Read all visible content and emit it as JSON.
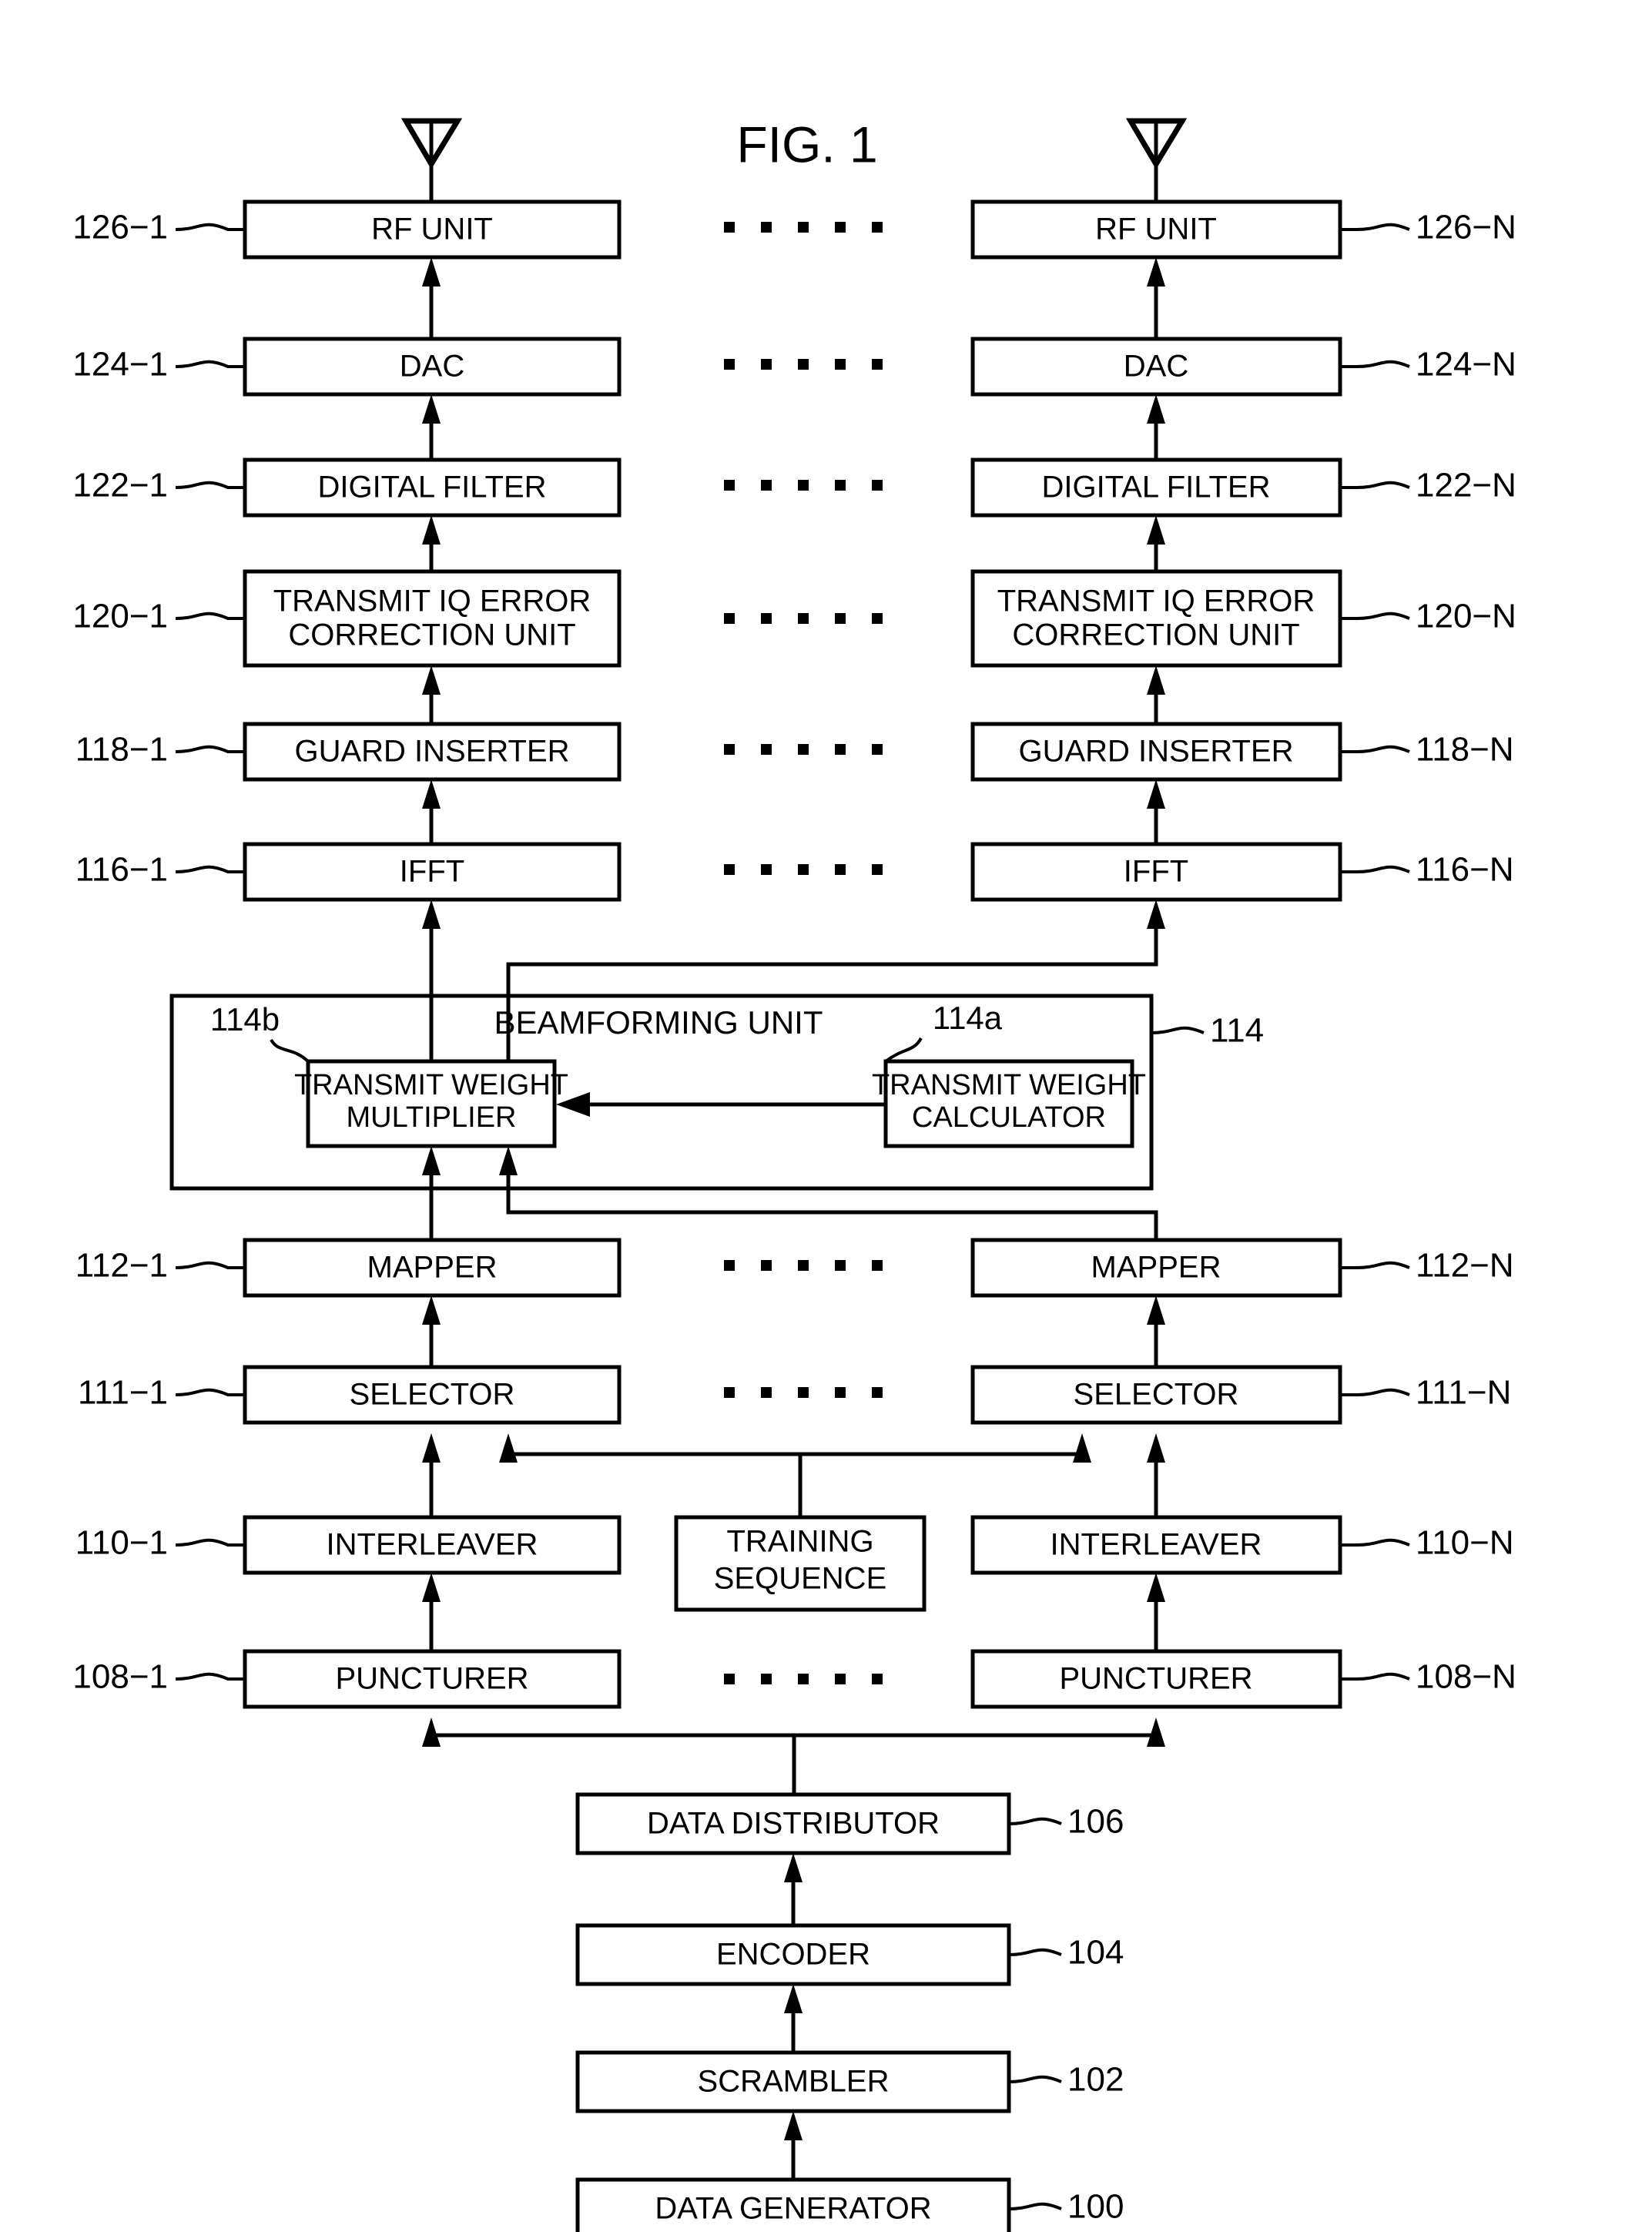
{
  "figure": {
    "title": "FIG. 1",
    "kind": "patent-block-diagram"
  },
  "columns": {
    "left_suffix": "1",
    "right_suffix": "N"
  },
  "chain_blocks": [
    {
      "label": "RF UNIT",
      "ref_left": "126−1",
      "ref_right": "126−N"
    },
    {
      "label": "DAC",
      "ref_left": "124−1",
      "ref_right": "124−N"
    },
    {
      "label": "DIGITAL FILTER",
      "ref_left": "122−1",
      "ref_right": "122−N"
    },
    {
      "label": "TRANSMIT IQ ERROR CORRECTION UNIT",
      "ref_left": "120−1",
      "ref_right": "120−N",
      "line1": "TRANSMIT IQ ERROR",
      "line2": "CORRECTION UNIT"
    },
    {
      "label": "GUARD INSERTER",
      "ref_left": "118−1",
      "ref_right": "118−N"
    },
    {
      "label": "IFFT",
      "ref_left": "116−1",
      "ref_right": "116−N"
    },
    {
      "label": "MAPPER",
      "ref_left": "112−1",
      "ref_right": "112−N"
    },
    {
      "label": "SELECTOR",
      "ref_left": "111−1",
      "ref_right": "111−N"
    },
    {
      "label": "INTERLEAVER",
      "ref_left": "110−1",
      "ref_right": "110−N"
    },
    {
      "label": "PUNCTURER",
      "ref_left": "108−1",
      "ref_right": "108−N"
    }
  ],
  "beamforming": {
    "unit_title": "BEAMFORMING UNIT",
    "unit_ref": "114",
    "multiplier": {
      "line1": "TRANSMIT WEIGHT",
      "line2": "MULTIPLIER",
      "ref": "114b"
    },
    "calculator": {
      "line1": "TRANSMIT WEIGHT",
      "line2": "CALCULATOR",
      "ref": "114a"
    }
  },
  "training_sequence": {
    "line1": "TRAINING",
    "line2": "SEQUENCE"
  },
  "common_blocks": [
    {
      "label": "DATA DISTRIBUTOR",
      "ref": "106"
    },
    {
      "label": "ENCODER",
      "ref": "104"
    },
    {
      "label": "SCRAMBLER",
      "ref": "102"
    },
    {
      "label": "DATA GENERATOR",
      "ref": "100"
    }
  ],
  "icons": {
    "antenna": "antenna-icon",
    "ellipsis": "horizontal-ellipsis"
  },
  "colors": {
    "ink": "#000000",
    "paper": "#ffffff"
  }
}
